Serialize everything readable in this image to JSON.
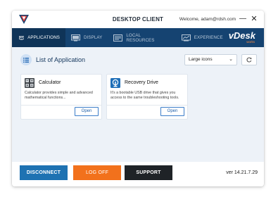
{
  "window": {
    "title": "DESKTOP CLIENT",
    "welcome": "Welcome, adam@rdsh.com",
    "minimize_glyph": "—",
    "close_glyph": "✕"
  },
  "nav": {
    "items": [
      {
        "label": "APPLICATIONS",
        "icon": "applications-icon",
        "active": true
      },
      {
        "label": "DISPLAY",
        "icon": "display-icon",
        "active": false
      },
      {
        "label": "LOCAL RESOURCES",
        "icon": "local-resources-icon",
        "active": false
      },
      {
        "label": "EXPERIENCE",
        "icon": "experience-icon",
        "active": false
      }
    ],
    "brand": {
      "name": "vDesk",
      "sub": "works"
    }
  },
  "main": {
    "title": "List of Application",
    "view_select": {
      "value": "Large icons"
    },
    "cards": [
      {
        "title": "Calculator",
        "description": "Calculator provides simple and advanced mathematical functions...",
        "button": "Open",
        "icon": "calculator-icon"
      },
      {
        "title": "Recovery Drive",
        "description": "It's a bootable USB drive that gives you access to the same troubleshooting tools.",
        "button": "Open",
        "icon": "recovery-drive-icon"
      }
    ]
  },
  "footer": {
    "disconnect": "DISCONNECT",
    "logoff": "LOG OFF",
    "support": "SUPPORT",
    "version": "ver 14.21.7.29"
  },
  "colors": {
    "nav_bg": "#154371",
    "nav_active_bg": "#0f3458",
    "content_bg": "#edf2f8",
    "disconnect": "#1e72b2",
    "logoff": "#f2711c",
    "support": "#1f2327",
    "brand_accent": "#ff8a3d"
  }
}
